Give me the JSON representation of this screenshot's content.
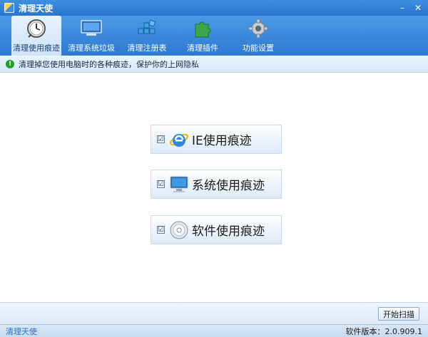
{
  "window": {
    "title": "清理天使",
    "minimize": "–",
    "close": "✕"
  },
  "toolbar": {
    "tabs": [
      {
        "label": "清理使用痕迹",
        "icon": "clock-icon",
        "active": true
      },
      {
        "label": "清理系统垃圾",
        "icon": "monitor-icon",
        "active": false
      },
      {
        "label": "清理注册表",
        "icon": "registry-icon",
        "active": false
      },
      {
        "label": "清理插件",
        "icon": "puzzle-icon",
        "active": false
      },
      {
        "label": "功能设置",
        "icon": "gear-icon",
        "active": false
      }
    ]
  },
  "info": {
    "text": "清理掉您使用电脑时的各种痕迹，保护你的上网隐私",
    "icon": "!"
  },
  "options": [
    {
      "label": "IE使用痕迹",
      "icon": "ie-icon",
      "checked": "☑"
    },
    {
      "label": "系统使用痕迹",
      "icon": "monitor-icon",
      "checked": "☑"
    },
    {
      "label": "软件使用痕迹",
      "icon": "disc-icon",
      "checked": "☑"
    }
  ],
  "bottom": {
    "start_label": "开始扫描"
  },
  "status": {
    "left": "清理天使",
    "right": "软件版本：2.0.909.1"
  },
  "colors": {
    "titlebar": "#2a74cf",
    "accent": "#3f8fe0",
    "status_link": "#2a6fc2"
  }
}
